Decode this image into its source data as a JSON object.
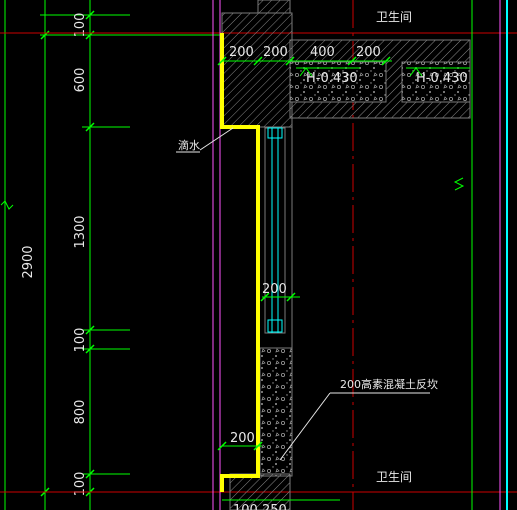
{
  "drawing": {
    "room_top": "卫生间",
    "room_bottom": "卫生间",
    "level_left": "H-0.430",
    "level_right": "H-0.430",
    "note_drip": "滴水",
    "note_sill": "200高素混凝土反坎",
    "dims_vertical": {
      "total": "2900",
      "d100_top": "100",
      "d600": "600",
      "d1300": "1300",
      "d100_mid": "100",
      "d800": "800",
      "d100_bot": "100"
    },
    "dims_horizontal": {
      "top_200a": "200",
      "top_200b": "200",
      "top_400": "400",
      "top_200c": "200",
      "window_200": "200",
      "bottom_200": "200",
      "bot_100": "100",
      "bot_250": "250"
    },
    "colors": {
      "background": "#000000",
      "outline_yellow": "#ffff00",
      "dimension_green": "#00ff00",
      "axis_red": "#cc0000",
      "cyan": "#00ffff",
      "magenta": "#ff00ff",
      "wall_gray": "#7a7a7a",
      "text_white": "#e8e8e8"
    }
  }
}
